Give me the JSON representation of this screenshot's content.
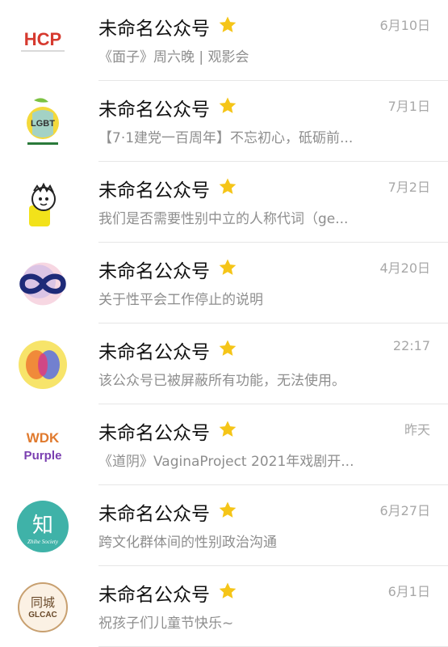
{
  "rows": [
    {
      "title": "未命名公众号",
      "time": "6月10日",
      "preview": "《面子》周六晚 | 观影会",
      "avatar": "hcp-logo",
      "logo_text": "HCP"
    },
    {
      "title": "未命名公众号",
      "time": "7月1日",
      "preview": "【7·1建党一百周年】不忘初心，砥砺前...",
      "avatar": "lgbt-fruit-logo",
      "logo_text": "LGBT"
    },
    {
      "title": "未命名公众号",
      "time": "7月2日",
      "preview": "我们是否需要性别中立的人称代词（ge...",
      "avatar": "cartoon-mascot-logo",
      "logo_text": ""
    },
    {
      "title": "未命名公众号",
      "time": "4月20日",
      "preview": "关于性平会工作停止的说明",
      "avatar": "infinity-logo",
      "logo_text": ""
    },
    {
      "title": "未命名公众号",
      "time": "22:17",
      "preview": "该公众号已被屏蔽所有功能，无法使用。",
      "avatar": "color-blob-logo",
      "logo_text": ""
    },
    {
      "title": "未命名公众号",
      "time": "昨天",
      "preview": "《道阴》VaginaProject 2021年戏剧开...",
      "avatar": "wdk-purple-logo",
      "logo_text": "WDK Purple"
    },
    {
      "title": "未命名公众号",
      "time": "6月27日",
      "preview": "跨文化群体间的性别政治沟通",
      "avatar": "zhihe-society-logo",
      "logo_text": "知"
    },
    {
      "title": "未命名公众号",
      "time": "6月1日",
      "preview": "祝孩子们儿童节快乐~",
      "avatar": "glcac-logo",
      "logo_text": "同城"
    }
  ],
  "colors": {
    "star": "#f5c518",
    "title": "#111111",
    "preview": "#8e8e8e",
    "time": "#a8a8a8"
  }
}
